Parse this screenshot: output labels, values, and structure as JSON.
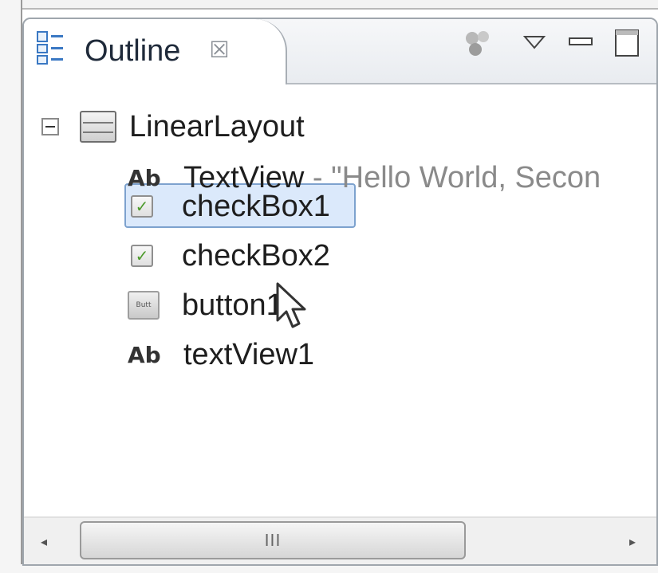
{
  "outline": {
    "tab_title": "Outline",
    "tab_close_icon": "close-icon",
    "toolbar_icons": [
      "link-with-editor-icon",
      "view-menu-icon",
      "minimize-icon",
      "maximize-icon"
    ]
  },
  "tree": {
    "root": {
      "label": "LinearLayout",
      "icon": "linear-layout-icon",
      "expanded": true
    },
    "children": [
      {
        "type": "textview",
        "icon_text": "Ab",
        "label": "TextView",
        "suffix": " - \"Hello World, Secon"
      },
      {
        "type": "checkbox",
        "icon_text": "✓",
        "label": "checkBox1",
        "selected": true
      },
      {
        "type": "checkbox",
        "icon_text": "✓",
        "label": "checkBox2"
      },
      {
        "type": "button",
        "icon_text": "Butt",
        "label": "button1"
      },
      {
        "type": "textview",
        "icon_text": "Ab",
        "label": "textView1"
      }
    ]
  },
  "scrollbar": {
    "grip": "III",
    "left_icon": "scroll-left-icon",
    "right_icon": "scroll-right-icon"
  },
  "colors": {
    "selection_bg": "#dbe9fb",
    "selection_border": "#7da2ce",
    "checkbox_check": "#4c9a2a"
  }
}
